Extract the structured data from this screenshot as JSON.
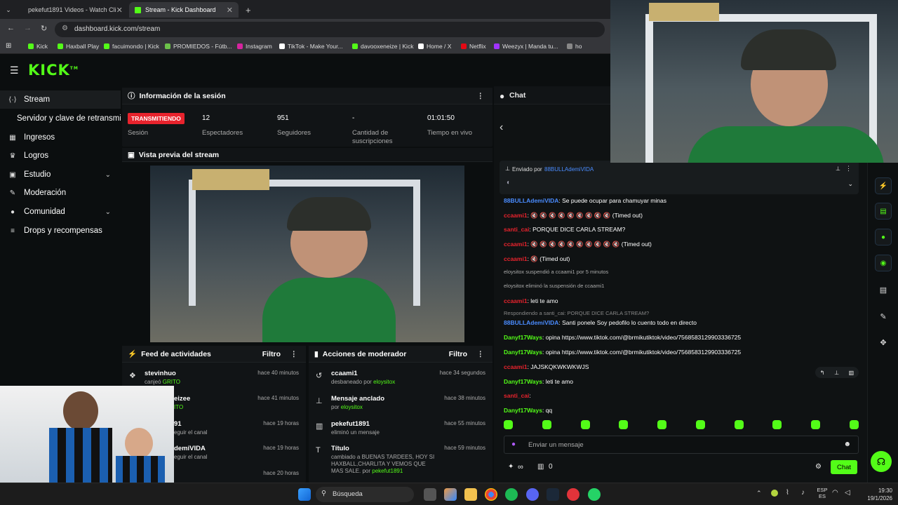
{
  "browser": {
    "tabs": [
      {
        "title": "pekefut1891 Videos - Watch Cli"
      },
      {
        "title": "Stream - Kick Dashboard"
      }
    ],
    "new_tab": "+",
    "url": "dashboard.kick.com/stream",
    "bookmarks": [
      "Kick",
      "Haxball Play",
      "facuimondo | Kick",
      "PROMIEDOS - Fútb...",
      "Instagram",
      "TikTok - Make Your...",
      "davooxeneize | Kick",
      "Home / X",
      "Netflix",
      "Weezyx | Manda tu...",
      "ho"
    ]
  },
  "app": {
    "logo": "KICK",
    "logo_sup": "TM"
  },
  "sidebar": {
    "items": [
      {
        "icon": "stream-icon",
        "glyph": "⟨·⟩",
        "label": "Stream"
      },
      {
        "icon": "",
        "glyph": "",
        "label": "Servidor y clave de retransmisión"
      },
      {
        "icon": "chart-icon",
        "glyph": "▦",
        "label": "Ingresos"
      },
      {
        "icon": "trophy-icon",
        "glyph": "♛",
        "label": "Logros"
      },
      {
        "icon": "studio-icon",
        "glyph": "▣",
        "label": "Estudio"
      },
      {
        "icon": "wrench-icon",
        "glyph": "✎",
        "label": "Moderación"
      },
      {
        "icon": "community-icon",
        "glyph": "●",
        "label": "Comunidad"
      },
      {
        "icon": "drops-icon",
        "glyph": "≡",
        "label": "Drops y recompensas"
      }
    ]
  },
  "session": {
    "title": "Información de la sesión",
    "live_badge": "TRANSMITIENDO",
    "metrics": [
      {
        "value": "",
        "label": "Sesión"
      },
      {
        "value": "12",
        "label": "Espectadores"
      },
      {
        "value": "951",
        "label": "Seguidores"
      },
      {
        "value": "-",
        "label": "Cantidad de suscripciones"
      },
      {
        "value": "01:01:50",
        "label": "Tiempo en vivo"
      }
    ]
  },
  "preview": {
    "title": "Vista previa del stream"
  },
  "activity": {
    "title": "Feed de actividades",
    "filter": "Filtro",
    "items": [
      {
        "user": "stevinhuo",
        "sub_pre": "canjeó ",
        "sub_hl": "GRITO",
        "time": "hace 40 minutos"
      },
      {
        "user": "eizee",
        "sub_pre": "",
        "sub_hl": "ITO",
        "time": "hace 41 minutos"
      },
      {
        "user": "91",
        "sub_pre": "eguir el canal",
        "sub_hl": "",
        "time": "hace 19 horas"
      },
      {
        "user": "demiVIDA",
        "sub_pre": "eguir el canal",
        "sub_hl": "",
        "time": "hace 19 horas"
      },
      {
        "user": "",
        "sub_pre": "",
        "sub_hl": "",
        "time": "hace 20 horas"
      }
    ]
  },
  "modactions": {
    "title": "Acciones de moderador",
    "filter": "Filtro",
    "items": [
      {
        "glyph": "↺",
        "title": "ccaami1",
        "sub_pre": "desbaneado por ",
        "sub_hl": "eloysitox",
        "time": "hace 34 segundos"
      },
      {
        "glyph": "⊥",
        "title": "Mensaje anclado",
        "sub_pre": "por ",
        "sub_hl": "eloysitox",
        "time": "hace 38 minutos"
      },
      {
        "glyph": "▥",
        "title": "pekefut1891",
        "sub_pre": "eliminó un mensaje",
        "sub_hl": "",
        "time": "hace 55 minutos"
      },
      {
        "glyph": "T",
        "title": "Título",
        "sub_pre": "cambiado a BUENAS TARDEES, HOY SI HAXBALL,CHARLITA Y VEMOS QUE MAS SALE. por ",
        "sub_hl": "pekefut1891",
        "time": "hace 59 minutos"
      }
    ]
  },
  "chat": {
    "title": "Chat",
    "pinned_label": "Enviado por",
    "pinned_user": "88BULLAdemiVIDA",
    "messages": [
      {
        "user": "88BULLAdemiVIDA",
        "ucolor": "#4a8cff",
        "text": "Se puede ocupar para chamuyar minas"
      },
      {
        "user": "ccaami1",
        "ucolor": "#e8232d",
        "text": "🔇 🔇 🔇 🔇 🔇 🔇 🔇 🔇 🔇  (Timed out)"
      },
      {
        "user": "santi_cai",
        "ucolor": "#e8232d",
        "text": "PORQUE DICE CARLA STREAM?"
      },
      {
        "user": "ccaami1",
        "ucolor": "#e8232d",
        "text": "🔇 🔇 🔇 🔇 🔇 🔇 🔇 🔇 🔇 🔇  (Timed out)"
      },
      {
        "user": "ccaami1",
        "ucolor": "#e8232d",
        "text": "🔇  (Timed out)"
      },
      {
        "user": "",
        "ucolor": "#aaa",
        "text": "eloysitox suspendió a ccaami1 por 5 minutos"
      },
      {
        "user": "",
        "ucolor": "#aaa",
        "text": "eloysitox eliminó la suspensión de ccaami1"
      },
      {
        "user": "ccaami1",
        "ucolor": "#e8232d",
        "text": "leti te amo"
      },
      {
        "user": "",
        "ucolor": "#888",
        "text": "Respondiendo a santi_cai: PORQUE DICE CARLA STREAM?"
      },
      {
        "user": "88BULLAdemiVIDA",
        "ucolor": "#4a8cff",
        "text": "Santi ponele Soy pedofilo lo cuento todo en directo"
      },
      {
        "user": "Danyf17Ways",
        "ucolor": "#53fc18",
        "text": "opina https://www.tiktok.com/@brmikutiktok/video/7568583129903336725"
      },
      {
        "user": "Danyf17Ways",
        "ucolor": "#53fc18",
        "text": "opina https://www.tiktok.com/@brmikutiktok/video/7568583129903336725"
      },
      {
        "user": "ccaami1",
        "ucolor": "#e8232d",
        "text": "JAJSKQKWKWKWJS"
      },
      {
        "user": "Danyf17Ways",
        "ucolor": "#53fc18",
        "text": "leti te amo"
      },
      {
        "user": "santi_cai",
        "ucolor": "#e8232d",
        "text": ""
      },
      {
        "user": "Danyf17Ways",
        "ucolor": "#53fc18",
        "text": "qq"
      }
    ],
    "input_placeholder": "Enviar un mensaje",
    "points": "∞",
    "gift_count": "0",
    "send": "Chat"
  },
  "taskbar": {
    "search": "Búsqueda",
    "lang": "ESP ES",
    "time": "19:30",
    "date": "19/1/2026"
  },
  "colors": {
    "accent": "#53fc18",
    "live": "#e8232d",
    "bg": "#0b0e0f"
  }
}
